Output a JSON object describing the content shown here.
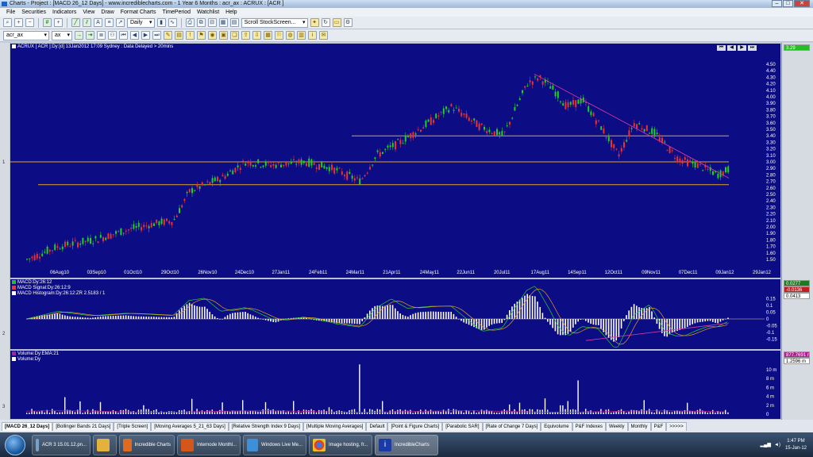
{
  "window": {
    "title": "Charts - Project : [MACD 26_12 Days] - www.incrediblecharts.com - 1 Year 6 Months : acr_ax : ACRUX : [ACR ]"
  },
  "menu": [
    "File",
    "Securities",
    "Indicators",
    "View",
    "Draw",
    "Format Charts",
    "TimePeriod",
    "Watchlist",
    "Help"
  ],
  "toolbar": {
    "period": "Daily",
    "scroll": "Scroll StockScreen...",
    "symbol": "acr_ax",
    "exchange": "ax"
  },
  "price_panel": {
    "header": "ACRUX [ ACR ]:Dy:[d]  13Jan2012 17:09 Sydney : Data Delayed > 20mins",
    "last_price": "3.29",
    "strip": "1",
    "yticks": [
      "4.50",
      "4.40",
      "4.30",
      "4.20",
      "4.10",
      "4.00",
      "3.90",
      "3.80",
      "3.70",
      "3.60",
      "3.50",
      "3.40",
      "3.30",
      "3.20",
      "3.10",
      "3.00",
      "2.90",
      "2.80",
      "2.70",
      "2.60",
      "2.50",
      "2.40",
      "2.30",
      "2.20",
      "2.10",
      "2.00",
      "1.90",
      "1.80",
      "1.70",
      "1.60",
      "1.50"
    ],
    "xticks": [
      "06Aug10",
      "03Sep10",
      "01Oct10",
      "29Oct10",
      "26Nov10",
      "24Dec10",
      "27Jan11",
      "24Feb11",
      "24Mar11",
      "21Apr11",
      "24May11",
      "22Jun11",
      "20Jul11",
      "17Aug11",
      "14Sep11",
      "12Oct11",
      "09Nov11",
      "07Dec11",
      "09Jan12",
      "29Jan12"
    ]
  },
  "macd_panel": {
    "legend": [
      "MACD:Dy:26:12",
      "MACD Signal:Dy:26:12:9",
      "MACD Histogram:Dy:26:12:ZR 2.5183 / 1"
    ],
    "readouts": [
      "0.0277",
      "-0.0136",
      "0.0413"
    ],
    "readout_colors": [
      "#1f7a1f",
      "#c02020",
      "#ffffff"
    ],
    "strip": "2",
    "yticks": [
      "0.15",
      "0.1",
      "0.05",
      "0",
      "-0.05",
      "-0.1",
      "-0.15"
    ]
  },
  "volume_panel": {
    "legend": [
      "Volume:Dy:EMA:21",
      "Volume:Dy"
    ],
    "readouts": [
      "877.7691 m",
      "1.2596 m"
    ],
    "readout_colors": [
      "#b0208f",
      "#ffffff"
    ],
    "strip": "3",
    "yticks": [
      "10 m",
      "8 m",
      "6 m",
      "4 m",
      "2 m",
      "0"
    ]
  },
  "colors": {
    "chart_bg": "#0c0c84",
    "up_candle": "#22d022",
    "down_candle": "#e83232",
    "hline": "#e8a31f",
    "trendline": "#e03aa0"
  },
  "tabs": [
    "[MACD 26_12 Days]",
    "[Bollinger Bands 21 Days]",
    "[Triple Screen]",
    "[Moving Averages 5_21_63 Days]",
    "[Relative Strength Index 9 Days]",
    "[Multiple Moving Averages]",
    "Default",
    "[Point & Figure Charts]",
    "[Parabolic SAR]",
    "[Rate of Change 7 Days]",
    "Equivolume",
    "P&F Indexes",
    "Weekly",
    "Monthly",
    "P&F",
    ">>>>>"
  ],
  "taskbar": {
    "items": [
      "ACR 3 15.01.12.pn...",
      "",
      "Incredible Charts",
      "Internode Monthl...",
      "Windows Live Me...",
      "Image hosting, fr...",
      "IncredibleCharts"
    ],
    "time": "1:47 PM",
    "date": "15-Jan-12"
  }
}
